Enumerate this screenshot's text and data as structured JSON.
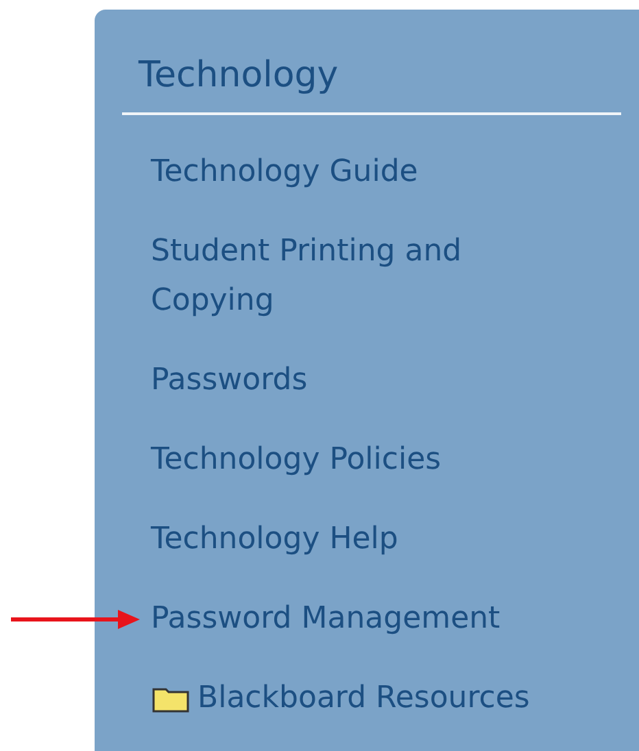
{
  "panel": {
    "title": "Technology",
    "items": [
      {
        "kind": "link",
        "label": "Technology Guide",
        "arrow": false
      },
      {
        "kind": "link",
        "label": "Student Printing and Copying",
        "arrow": false
      },
      {
        "kind": "link",
        "label": "Passwords",
        "arrow": false
      },
      {
        "kind": "link",
        "label": "Technology Policies",
        "arrow": false
      },
      {
        "kind": "link",
        "label": "Technology Help",
        "arrow": false
      },
      {
        "kind": "link",
        "label": "Password Management",
        "arrow": true
      },
      {
        "kind": "folder",
        "label": "Blackboard Resources",
        "arrow": false
      }
    ]
  }
}
